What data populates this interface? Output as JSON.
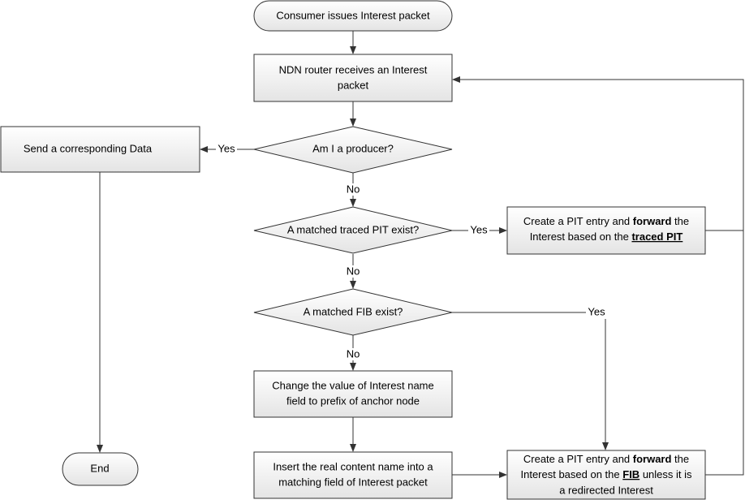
{
  "nodes": {
    "start": "Consumer issues Interest packet",
    "receive": [
      "NDN router receives an Interest",
      "packet"
    ],
    "producer_q": "Am I a producer?",
    "send_data": "Send a corresponding Data",
    "pit_q": "A matched traced PIT exist?",
    "pit_forward": {
      "l1a": "Create a PIT entry and ",
      "l1b": "forward",
      "l1c": " the",
      "l2a": "Interest based on the ",
      "l2b": "traced PIT"
    },
    "fib_q": "A matched FIB exist?",
    "change": [
      "Change  the value of Interest name",
      "field to prefix of anchor node"
    ],
    "insert": [
      "Insert the real content name into a",
      "matching field of Interest packet"
    ],
    "fib_forward": {
      "l1a": "Create a PIT entry and ",
      "l1b": "forward",
      "l1c": " the",
      "l2a": "Interest based on the ",
      "l2b": "FIB",
      "l2c": " unless it is",
      "l3": "a redirected Interest"
    },
    "end": "End"
  },
  "labels": {
    "yes": "Yes",
    "no": "No"
  },
  "colors": {
    "stroke": "#333333",
    "fill_top": "#ffffff",
    "fill_bottom": "#e6e6e6"
  }
}
